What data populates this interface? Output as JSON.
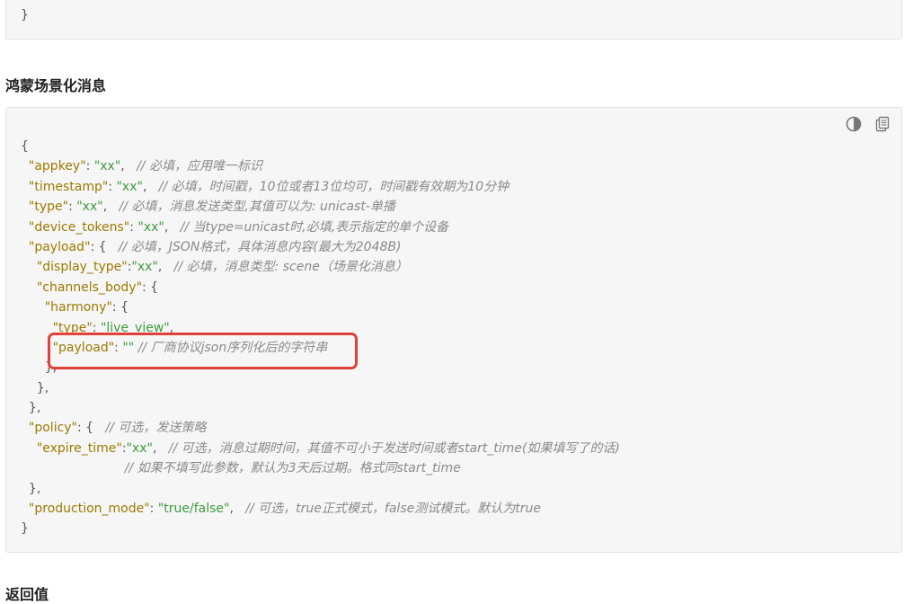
{
  "previous_block": {
    "closing_brace": "}"
  },
  "section_title": "鸿蒙场景化消息",
  "toolbar": {
    "theme_icon": "theme-toggle-icon",
    "copy_icon": "copy-icon"
  },
  "code": {
    "lines": [
      {
        "indent": "",
        "tokens": [
          {
            "t": "p",
            "v": "{"
          }
        ]
      },
      {
        "indent": "  ",
        "tokens": [
          {
            "t": "k",
            "v": "\"appkey\""
          },
          {
            "t": "p",
            "v": ": "
          },
          {
            "t": "s",
            "v": "\"xx\""
          },
          {
            "t": "p",
            "v": ",   "
          },
          {
            "t": "c",
            "v": "// 必填，应用唯一标识"
          }
        ]
      },
      {
        "indent": "  ",
        "tokens": [
          {
            "t": "k",
            "v": "\"timestamp\""
          },
          {
            "t": "p",
            "v": ": "
          },
          {
            "t": "s",
            "v": "\"xx\""
          },
          {
            "t": "p",
            "v": ",   "
          },
          {
            "t": "c",
            "v": "// 必填，时间戳，10位或者13位均可，时间戳有效期为10分钟"
          }
        ]
      },
      {
        "indent": "  ",
        "tokens": [
          {
            "t": "k",
            "v": "\"type\""
          },
          {
            "t": "p",
            "v": ": "
          },
          {
            "t": "s",
            "v": "\"xx\""
          },
          {
            "t": "p",
            "v": ",   "
          },
          {
            "t": "c",
            "v": "// 必填，消息发送类型,其值可以为: unicast-单播"
          }
        ]
      },
      {
        "indent": "  ",
        "tokens": [
          {
            "t": "k",
            "v": "\"device_tokens\""
          },
          {
            "t": "p",
            "v": ": "
          },
          {
            "t": "s",
            "v": "\"xx\""
          },
          {
            "t": "p",
            "v": ",   "
          },
          {
            "t": "c",
            "v": "// 当type=unicast时,必填,表示指定的单个设备"
          }
        ]
      },
      {
        "indent": "  ",
        "tokens": [
          {
            "t": "k",
            "v": "\"payload\""
          },
          {
            "t": "p",
            "v": ": {   "
          },
          {
            "t": "c",
            "v": "// 必填，JSON格式，具体消息内容(最大为2048B)"
          }
        ]
      },
      {
        "indent": "    ",
        "tokens": [
          {
            "t": "k",
            "v": "\"display_type\""
          },
          {
            "t": "p",
            "v": ":"
          },
          {
            "t": "s",
            "v": "\"xx\""
          },
          {
            "t": "p",
            "v": ",   "
          },
          {
            "t": "c",
            "v": "// 必填，消息类型: scene（场景化消息）"
          }
        ]
      },
      {
        "indent": "    ",
        "tokens": [
          {
            "t": "k",
            "v": "\"channels_body\""
          },
          {
            "t": "p",
            "v": ": {"
          }
        ]
      },
      {
        "indent": "      ",
        "tokens": [
          {
            "t": "k",
            "v": "\"harmony\""
          },
          {
            "t": "p",
            "v": ": {"
          }
        ]
      },
      {
        "indent": "        ",
        "tokens": [
          {
            "t": "k",
            "v": "\"type\""
          },
          {
            "t": "p",
            "v": ": "
          },
          {
            "t": "s",
            "v": "\"live_view\""
          },
          {
            "t": "p",
            "v": ","
          }
        ]
      },
      {
        "indent": "        ",
        "tokens": [
          {
            "t": "k",
            "v": "\"payload\""
          },
          {
            "t": "p",
            "v": ": "
          },
          {
            "t": "s",
            "v": "\"\""
          },
          {
            "t": "p",
            "v": " "
          },
          {
            "t": "c",
            "v": "// 厂商协议json序列化后的字符串"
          }
        ]
      },
      {
        "indent": "      ",
        "tokens": [
          {
            "t": "p",
            "v": "},"
          }
        ]
      },
      {
        "indent": "    ",
        "tokens": [
          {
            "t": "p",
            "v": "},"
          }
        ]
      },
      {
        "indent": "  ",
        "tokens": [
          {
            "t": "p",
            "v": "},"
          }
        ]
      },
      {
        "indent": "  ",
        "tokens": [
          {
            "t": "k",
            "v": "\"policy\""
          },
          {
            "t": "p",
            "v": ": {   "
          },
          {
            "t": "c",
            "v": "// 可选，发送策略"
          }
        ]
      },
      {
        "indent": "    ",
        "tokens": [
          {
            "t": "k",
            "v": "\"expire_time\""
          },
          {
            "t": "p",
            "v": ":"
          },
          {
            "t": "s",
            "v": "\"xx\""
          },
          {
            "t": "p",
            "v": ",   "
          },
          {
            "t": "c",
            "v": "// 可选，消息过期时间，其值不可小于发送时间或者start_time(如果填写了的话)"
          }
        ]
      },
      {
        "indent": "                          ",
        "tokens": [
          {
            "t": "c",
            "v": "// 如果不填写此参数，默认为3天后过期。格式同start_time"
          }
        ]
      },
      {
        "indent": "  ",
        "tokens": [
          {
            "t": "p",
            "v": "},"
          }
        ]
      },
      {
        "indent": "  ",
        "tokens": [
          {
            "t": "k",
            "v": "\"production_mode\""
          },
          {
            "t": "p",
            "v": ": "
          },
          {
            "t": "s",
            "v": "\"true/false\""
          },
          {
            "t": "p",
            "v": ",   "
          },
          {
            "t": "c",
            "v": "// 可选，true正式模式，false测试模式。默认为true"
          }
        ]
      },
      {
        "indent": "",
        "tokens": [
          {
            "t": "p",
            "v": "}"
          }
        ]
      }
    ]
  },
  "next_section_title": "返回值"
}
